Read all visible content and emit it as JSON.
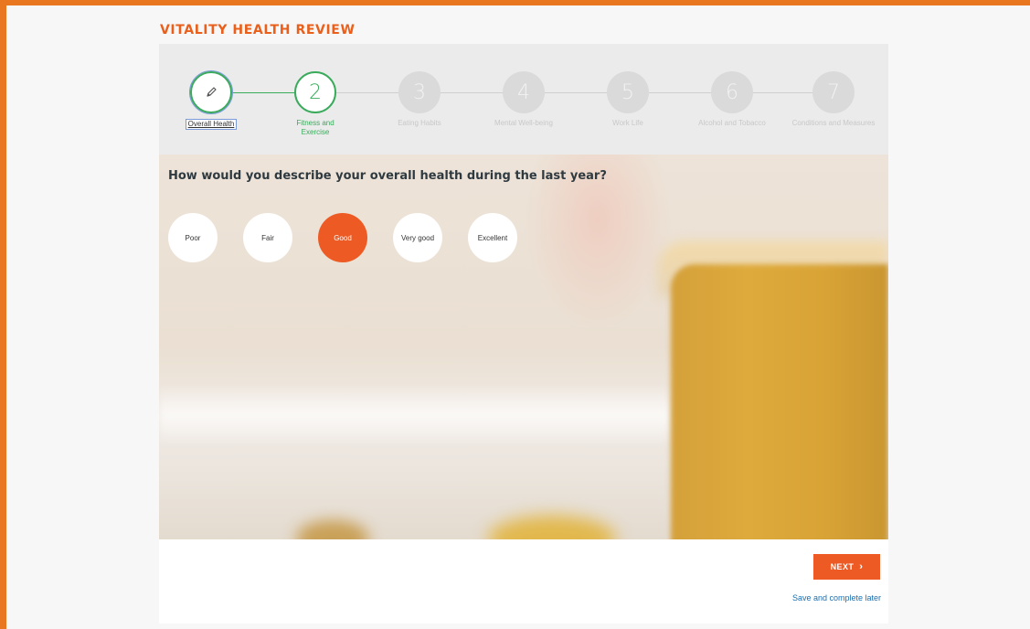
{
  "app": {
    "title": "VITALITY HEALTH REVIEW"
  },
  "stepper": {
    "steps": [
      {
        "number": "",
        "label": "Overall Health",
        "state": "done",
        "icon": "pencil-icon"
      },
      {
        "number": "2",
        "label": "Fitness and Exercise",
        "state": "current"
      },
      {
        "number": "3",
        "label": "Eating Habits",
        "state": "pending"
      },
      {
        "number": "4",
        "label": "Mental Well-being",
        "state": "pending"
      },
      {
        "number": "5",
        "label": "Work Life",
        "state": "pending"
      },
      {
        "number": "6",
        "label": "Alcohol and Tobacco",
        "state": "pending"
      },
      {
        "number": "7",
        "label": "Conditions and Measures",
        "state": "pending"
      }
    ]
  },
  "question": {
    "text": "How would you describe your overall health during the last year?",
    "options": [
      "Poor",
      "Fair",
      "Good",
      "Very good",
      "Excellent"
    ],
    "selected": "Good"
  },
  "footer": {
    "next_label": "NEXT",
    "save_label": "Save and complete later"
  },
  "colors": {
    "accent": "#ee5a24",
    "brand": "#e8601c",
    "progress": "#3aaa5b",
    "link": "#1a6fb0"
  }
}
